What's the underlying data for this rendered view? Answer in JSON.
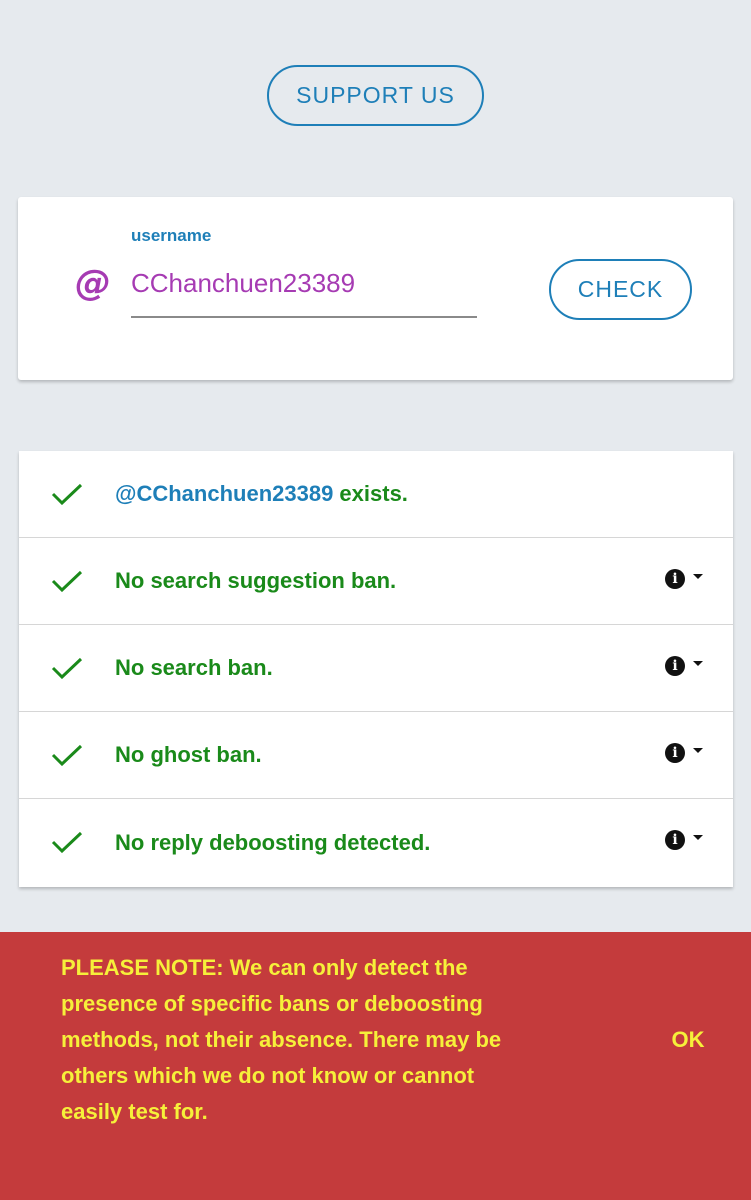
{
  "header": {
    "support_label": "SUPPORT US"
  },
  "search": {
    "at_symbol": "@",
    "label": "username",
    "value": "CChanchuen23389",
    "check_label": "CHECK"
  },
  "results": {
    "exists_user": "@CChanchuen23389",
    "exists_suffix": " exists.",
    "items": [
      {
        "label": "No search suggestion ban."
      },
      {
        "label": "No search ban."
      },
      {
        "label": "No ghost ban."
      },
      {
        "label": "No reply deboosting detected."
      }
    ],
    "status_color": "#1a8a1a",
    "info_glyph": "i"
  },
  "notice": {
    "line1": "PLEASE NOTE: We can only detect the",
    "line2": "presence of specific bans or deboosting",
    "line3": "methods, not their absence. There may be",
    "line4": "others which we do not know or cannot",
    "line5": "easily test for.",
    "ok_label": "OK",
    "background": "#c43b3c",
    "text_color": "#f6f03a"
  }
}
